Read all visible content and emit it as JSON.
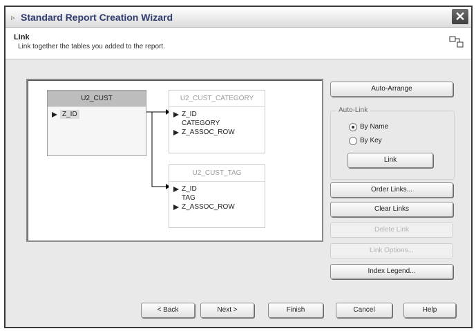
{
  "window": {
    "title": "Standard Report Creation Wizard"
  },
  "header": {
    "title": "Link",
    "subtitle": "Link together the tables you added to the report."
  },
  "tables": [
    {
      "name": "U2_CUST",
      "fields": [
        "Z_ID"
      ]
    },
    {
      "name": "U2_CUST_CATEGORY",
      "fields": [
        "Z_ID",
        "CATEGORY",
        "Z_ASSOC_ROW"
      ]
    },
    {
      "name": "U2_CUST_TAG",
      "fields": [
        "Z_ID",
        "TAG",
        "Z_ASSOC_ROW"
      ]
    }
  ],
  "side_buttons": {
    "auto_arrange": "Auto-Arrange",
    "order_links": "Order Links...",
    "clear_links": "Clear Links",
    "delete_link": "Delete Link",
    "link_options": "Link Options...",
    "index_legend": "Index Legend..."
  },
  "auto_link": {
    "label": "Auto-Link",
    "by_name": "By Name",
    "by_key": "By Key",
    "selected": "By Name",
    "link_button": "Link"
  },
  "footer": {
    "back": "< Back",
    "next": "Next >",
    "finish": "Finish",
    "cancel": "Cancel",
    "help": "Help"
  }
}
